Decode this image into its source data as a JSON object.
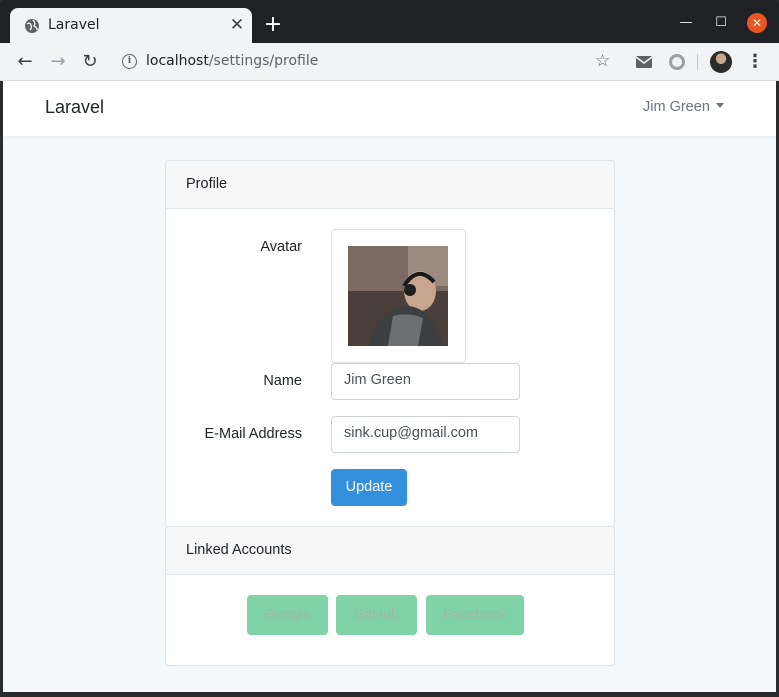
{
  "browser": {
    "tab_title": "Laravel",
    "url_host": "localhost",
    "url_path": "/settings/profile"
  },
  "navbar": {
    "brand": "Laravel",
    "user_name": "Jim Green"
  },
  "profile_card": {
    "header": "Profile",
    "avatar_label": "Avatar",
    "name_label": "Name",
    "name_value": "Jim Green",
    "email_label": "E-Mail Address",
    "email_value": "sink.cup@gmail.com",
    "update_button": "Update"
  },
  "linked_card": {
    "header": "Linked Accounts",
    "buttons": [
      "Google",
      "GitHub",
      "Facebook"
    ]
  },
  "colors": {
    "primary": "#3490dc",
    "success_disabled": "#7fd3a6",
    "close_button": "#e95420"
  }
}
